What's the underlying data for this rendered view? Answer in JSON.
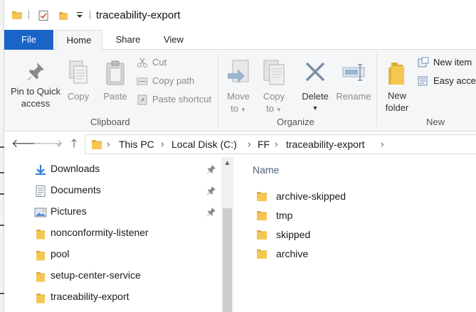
{
  "window": {
    "title": "traceability-export"
  },
  "quick_access_toolbar": {
    "icons": [
      "folder-icon",
      "properties-icon",
      "new-folder-icon",
      "customize-dropdown-icon"
    ]
  },
  "ribbon_tabs": [
    {
      "label": "File"
    },
    {
      "label": "Home"
    },
    {
      "label": "Share"
    },
    {
      "label": "View"
    }
  ],
  "ribbon": {
    "clipboard": {
      "group_label": "Clipboard",
      "pin_label_1": "Pin to Quick",
      "pin_label_2": "access",
      "copy_label": "Copy",
      "paste_label": "Paste",
      "cut_label": "Cut",
      "copy_path_label": "Copy path",
      "paste_shortcut_label": "Paste shortcut"
    },
    "organize": {
      "group_label": "Organize",
      "move_label_1": "Move",
      "move_label_2": "to",
      "copy_label_1": "Copy",
      "copy_label_2": "to",
      "delete_label": "Delete",
      "rename_label": "Rename"
    },
    "new": {
      "group_label": "New",
      "new_folder_label_1": "New",
      "new_folder_label_2": "folder",
      "new_item_label": "New item",
      "easy_access_label": "Easy acces"
    }
  },
  "address_bar": {
    "breadcrumbs": [
      "This PC",
      "Local Disk (C:)",
      "FF",
      "traceability-export"
    ]
  },
  "nav_pane": {
    "items": [
      {
        "label": "Downloads",
        "icon": "downloads-icon",
        "pinned": true
      },
      {
        "label": "Documents",
        "icon": "documents-icon",
        "pinned": true
      },
      {
        "label": "Pictures",
        "icon": "pictures-icon",
        "pinned": true
      },
      {
        "label": "nonconformity-listener",
        "icon": "folder-icon",
        "pinned": false
      },
      {
        "label": "pool",
        "icon": "folder-icon",
        "pinned": false
      },
      {
        "label": "setup-center-service",
        "icon": "folder-icon",
        "pinned": false
      },
      {
        "label": "traceability-export",
        "icon": "folder-icon",
        "pinned": false
      }
    ]
  },
  "file_list": {
    "column_name": "Name",
    "items": [
      {
        "name": "archive-skipped"
      },
      {
        "name": "tmp"
      },
      {
        "name": "skipped"
      },
      {
        "name": "archive"
      }
    ]
  },
  "colors": {
    "file_tab": "#1a64c8",
    "folder_yellow": "#f6c652",
    "ribbon_bg": "#f5f6f7"
  }
}
